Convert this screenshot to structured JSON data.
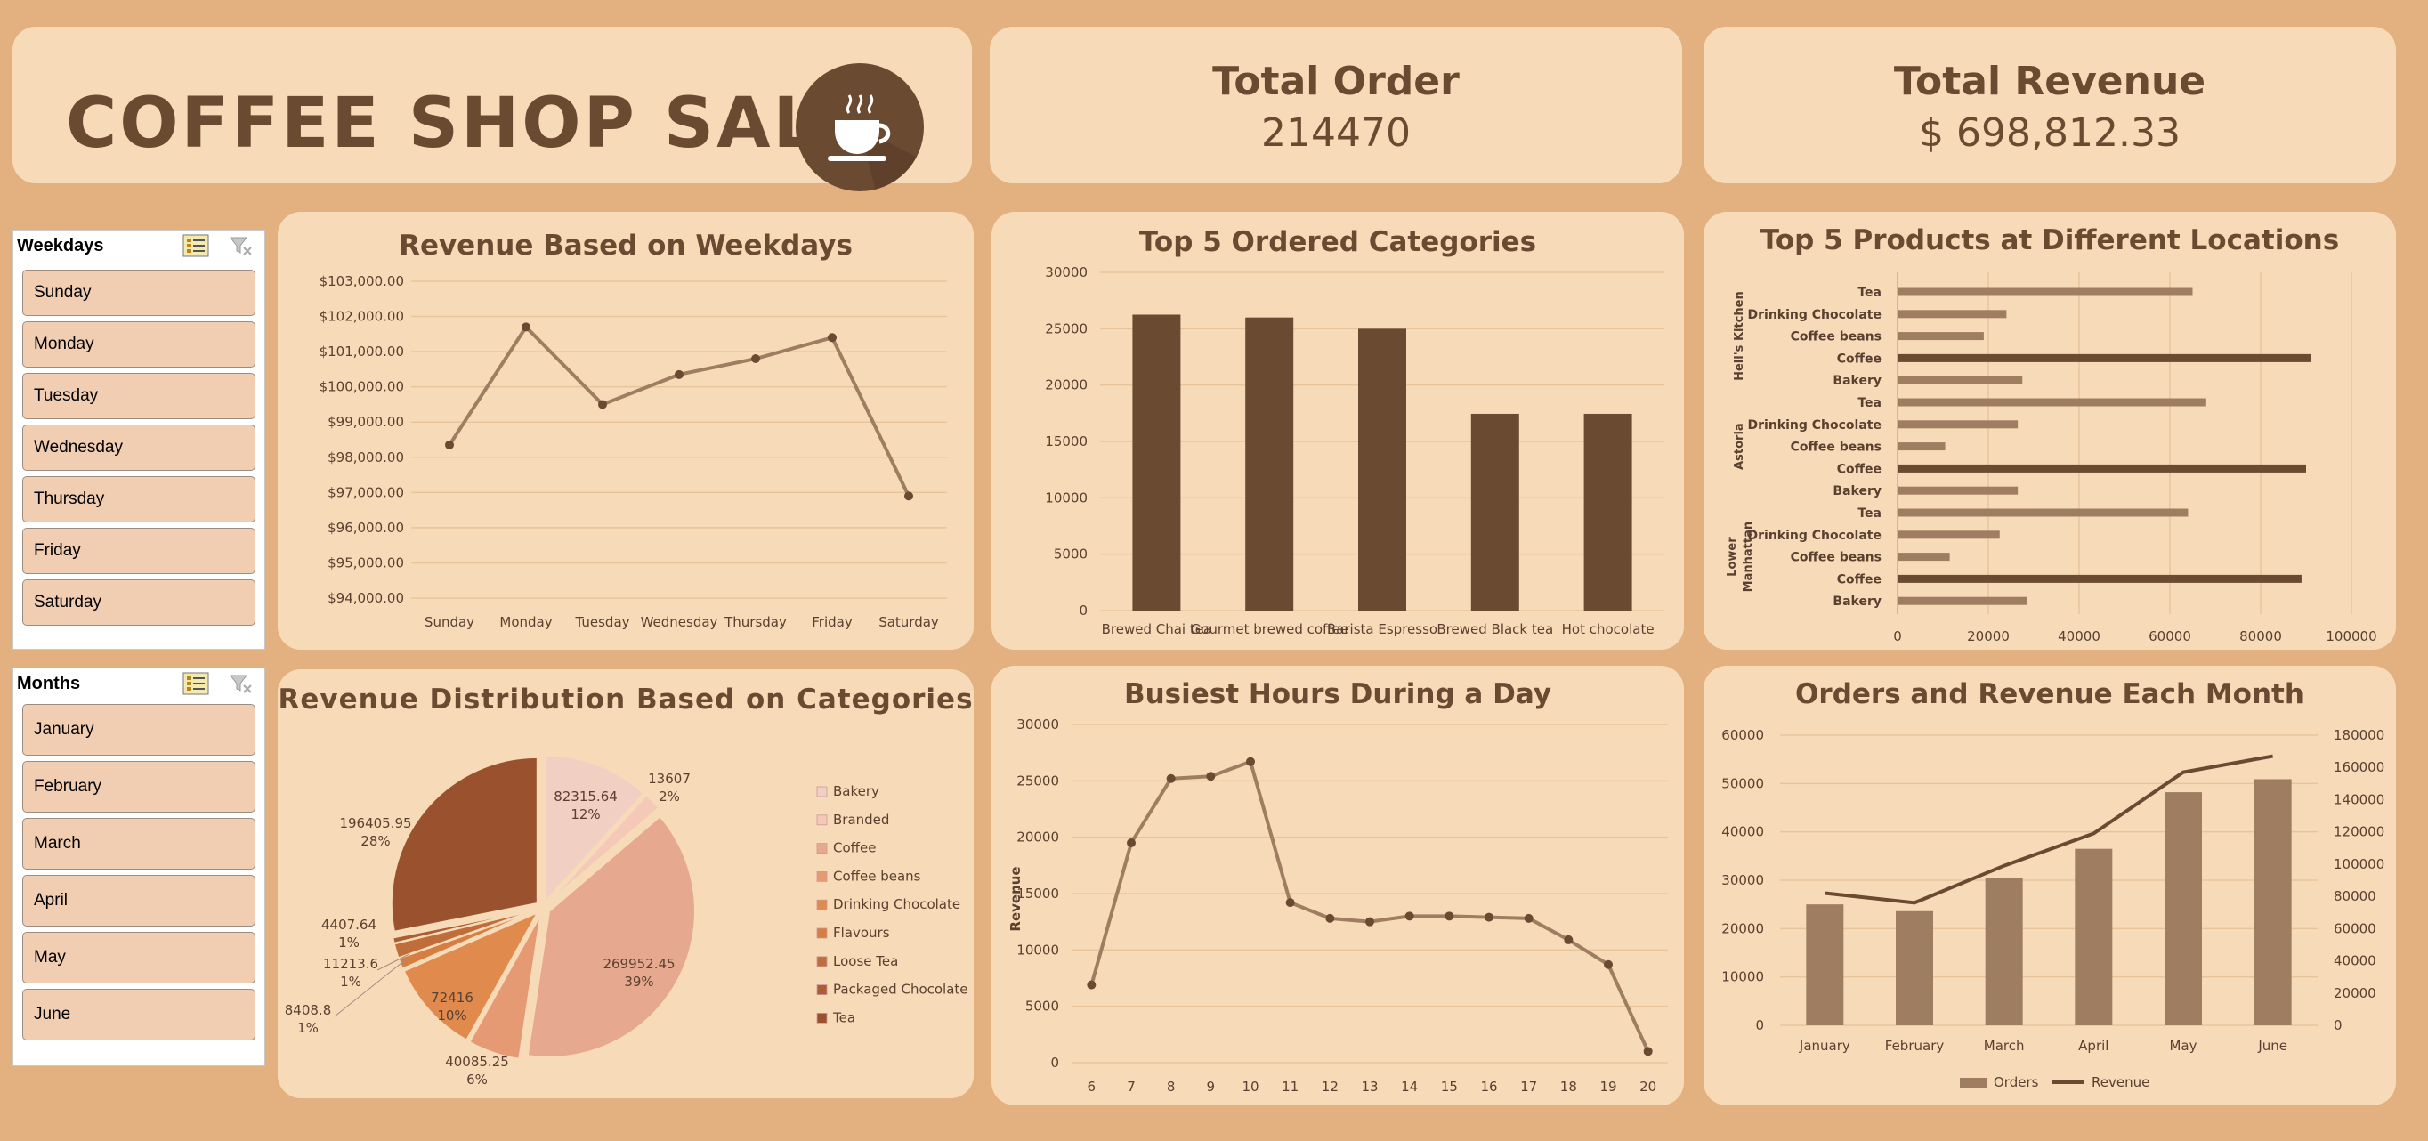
{
  "header": {
    "title": "COFFEE SHOP SALES",
    "logo_icon": "coffee-cup-icon"
  },
  "kpis": {
    "total_order": {
      "label": "Total Order",
      "value": "214470"
    },
    "total_revenue": {
      "label": "Total Revenue",
      "value": "$ 698,812.33"
    }
  },
  "slicers": {
    "weekdays": {
      "title": "Weekdays",
      "items": [
        "Sunday",
        "Monday",
        "Tuesday",
        "Wednesday",
        "Thursday",
        "Friday",
        "Saturday"
      ]
    },
    "months": {
      "title": "Months",
      "items": [
        "January",
        "February",
        "March",
        "April",
        "May",
        "June"
      ]
    }
  },
  "colors": {
    "background": "#e3b07f",
    "card": "#f7dbb8",
    "primary": "#6b4a32",
    "secondary": "#9f7d61"
  },
  "chart_data": [
    {
      "id": "weekday_revenue",
      "type": "line",
      "title": "Revenue Based on Weekdays",
      "categories": [
        "Sunday",
        "Monday",
        "Tuesday",
        "Wednesday",
        "Thursday",
        "Friday",
        "Saturday"
      ],
      "values": [
        98350,
        101700,
        99500,
        100350,
        100800,
        101400,
        96900
      ],
      "ylim": [
        94000,
        103000
      ],
      "yticks": [
        "$94,000.00",
        "$95,000.00",
        "$96,000.00",
        "$97,000.00",
        "$98,000.00",
        "$99,000.00",
        "$100,000.00",
        "$101,000.00",
        "$102,000.00",
        "$103,000.00"
      ],
      "grid": true
    },
    {
      "id": "top_categories",
      "type": "bar",
      "title": "Top 5 Ordered Categories",
      "categories": [
        "Brewed Chai tea",
        "Gourmet brewed coffee",
        "Barista Espresso",
        "Brewed Black tea",
        "Hot chocolate"
      ],
      "values": [
        26250,
        26000,
        25000,
        17450,
        17450
      ],
      "ylim": [
        0,
        30000
      ],
      "yticks": [
        "0",
        "5000",
        "10000",
        "15000",
        "20000",
        "25000",
        "30000"
      ],
      "grid": true
    },
    {
      "id": "top_products_locations",
      "type": "bar",
      "orientation": "horizontal",
      "title": "Top 5 Products at Different Locations",
      "groups": [
        {
          "name": "Hell's Kitchen",
          "items": [
            "Tea",
            "Drinking Chocolate",
            "Coffee beans",
            "Coffee",
            "Bakery"
          ],
          "values": [
            65000,
            24000,
            19000,
            91000,
            27500
          ]
        },
        {
          "name": "Astoria",
          "items": [
            "Tea",
            "Drinking Chocolate",
            "Coffee beans",
            "Coffee",
            "Bakery"
          ],
          "values": [
            68000,
            26500,
            10500,
            90000,
            26500
          ]
        },
        {
          "name": "Lower Manhattan",
          "items": [
            "Tea",
            "Drinking Chocolate",
            "Coffee beans",
            "Coffee",
            "Bakery"
          ],
          "values": [
            64000,
            22500,
            11500,
            89000,
            28500
          ]
        }
      ],
      "xlim": [
        0,
        100000
      ],
      "xticks": [
        "0",
        "20000",
        "40000",
        "60000",
        "80000",
        "100000"
      ],
      "grid": true
    },
    {
      "id": "category_revenue_distribution",
      "type": "pie",
      "title": "Revenue Distribution Based on Categories",
      "slices": [
        {
          "name": "Bakery",
          "value": 82315.64,
          "value_label": "82315.64",
          "percent": "12%",
          "color": "#f2cfc3"
        },
        {
          "name": "Branded",
          "value": 13607,
          "value_label": "13607",
          "percent": "2%",
          "color": "#f4c9b8"
        },
        {
          "name": "Coffee",
          "value": 269952.45,
          "value_label": "269952.45",
          "percent": "39%",
          "color": "#e6a98f"
        },
        {
          "name": "Coffee beans",
          "value": 40085.25,
          "value_label": "40085.25",
          "percent": "6%",
          "color": "#e59a74"
        },
        {
          "name": "Drinking Chocolate",
          "value": 72416,
          "value_label": "72416",
          "percent": "10%",
          "color": "#e08a4e"
        },
        {
          "name": "Flavours",
          "value": 8408.8,
          "value_label": "8408.8",
          "percent": "1%",
          "color": "#d47e42"
        },
        {
          "name": "Loose Tea",
          "value": 11213.6,
          "value_label": "11213.6",
          "percent": "1%",
          "color": "#bf6e3b"
        },
        {
          "name": "Packaged Chocolate",
          "value": 4407.64,
          "value_label": "4407.64",
          "percent": "1%",
          "color": "#ab5d34"
        },
        {
          "name": "Tea",
          "value": 196405.95,
          "value_label": "196405.95",
          "percent": "28%",
          "color": "#9a522e"
        }
      ]
    },
    {
      "id": "busiest_hours",
      "type": "line",
      "title": "Busiest Hours During a Day",
      "x": [
        "6",
        "7",
        "8",
        "9",
        "10",
        "11",
        "12",
        "13",
        "14",
        "15",
        "16",
        "17",
        "18",
        "19",
        "20"
      ],
      "values": [
        6900,
        19500,
        25200,
        25400,
        26700,
        14200,
        12800,
        12500,
        13000,
        13000,
        12900,
        12800,
        10900,
        8700,
        1000
      ],
      "ylabel": "Revenue",
      "ylim": [
        0,
        30000
      ],
      "yticks": [
        "0",
        "5000",
        "10000",
        "15000",
        "20000",
        "25000",
        "30000"
      ],
      "grid": true
    },
    {
      "id": "orders_revenue_month",
      "type": "bar",
      "title": "Orders and Revenue Each Month",
      "categories": [
        "January",
        "February",
        "March",
        "April",
        "May",
        "June"
      ],
      "series": [
        {
          "name": "Orders",
          "type": "bar",
          "values": [
            25000,
            23600,
            30400,
            36500,
            48200,
            50900
          ]
        },
        {
          "name": "Revenue",
          "type": "line",
          "axis": "right",
          "values": [
            82000,
            76000,
            99000,
            119000,
            157000,
            167000
          ]
        }
      ],
      "ylim": [
        0,
        60000
      ],
      "yticks_left": [
        "0",
        "10000",
        "20000",
        "30000",
        "40000",
        "50000",
        "60000"
      ],
      "ylim_right": [
        0,
        180000
      ],
      "yticks_right": [
        "0",
        "20000",
        "40000",
        "60000",
        "80000",
        "100000",
        "120000",
        "140000",
        "160000",
        "180000"
      ],
      "legend": "bottom",
      "grid": true
    }
  ]
}
